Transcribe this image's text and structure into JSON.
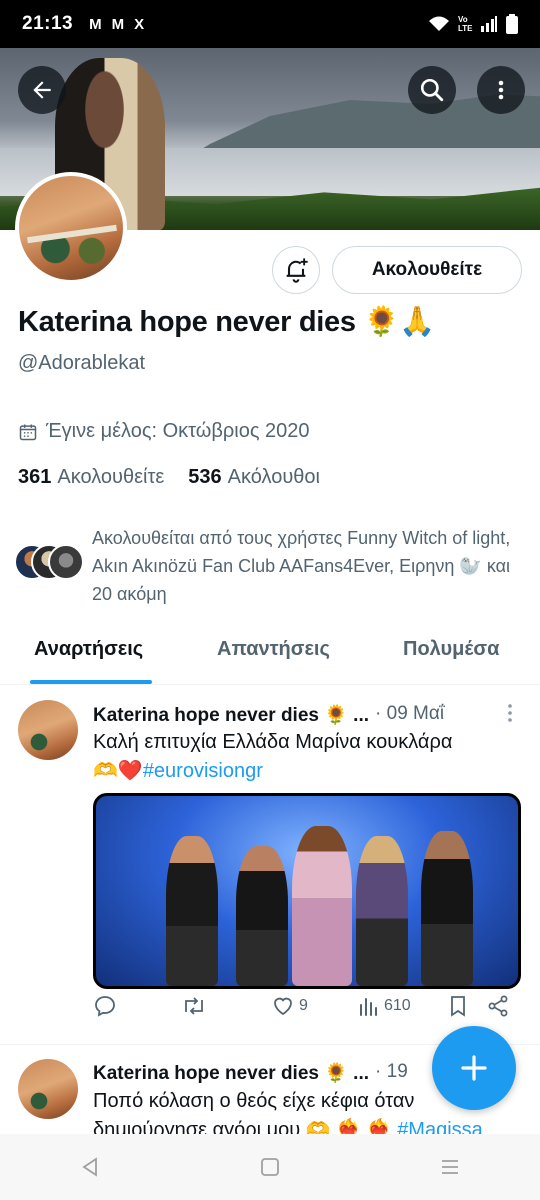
{
  "status_bar": {
    "time": "21:13",
    "notifications": [
      "M",
      "M",
      "X"
    ],
    "network": "Vo LTE"
  },
  "header": {
    "back_icon": "arrow-left-icon",
    "search_icon": "search-icon",
    "more_icon": "more-vertical-icon"
  },
  "profile": {
    "display_name": "Katerina hope never dies 🌻🙏",
    "handle": "@Adorablekat",
    "follow_button": "Ακολουθείτε",
    "joined": "Έγινε μέλος: Οκτώβριος 2020",
    "following_count": "361",
    "following_label": "Ακολουθείτε",
    "followers_count": "536",
    "followers_label": "Ακόλουθοι",
    "followed_by": "Ακολουθείται από τους χρήστες Funny Witch of light, Akın Akınözü Fan Club AAFans4Ever, Ειρηνη 🦭 και 20 ακόμη"
  },
  "tabs": [
    {
      "label": "Αναρτήσεις",
      "active": true
    },
    {
      "label": "Απαντήσεις",
      "active": false
    },
    {
      "label": "Πολυμέσα",
      "active": false
    }
  ],
  "posts": [
    {
      "name": "Katerina hope never dies 🌻 ...",
      "meta": "· 09 Μαΐ",
      "text_main": "Καλή επιτυχία Ελλάδα Μαρίνα κουκλάρα",
      "text_emoji": "🫶❤️",
      "hashtag": "#eurovisiongr",
      "likes": "9",
      "views": "610"
    },
    {
      "name": "Katerina hope never dies 🌻 ...",
      "meta": "· 19",
      "text_line1": "Ποπό κόλαση ο θεός είχε κέφια όταν",
      "text_line2": "δημιούργησε αγόρι μου 🫶 ❤️‍🔥 ❤️‍🔥",
      "hashtag": "#Magissa"
    }
  ],
  "colors": {
    "accent": "#1d9bf0",
    "secondary_text": "#536471",
    "primary_text": "#0f1419"
  }
}
